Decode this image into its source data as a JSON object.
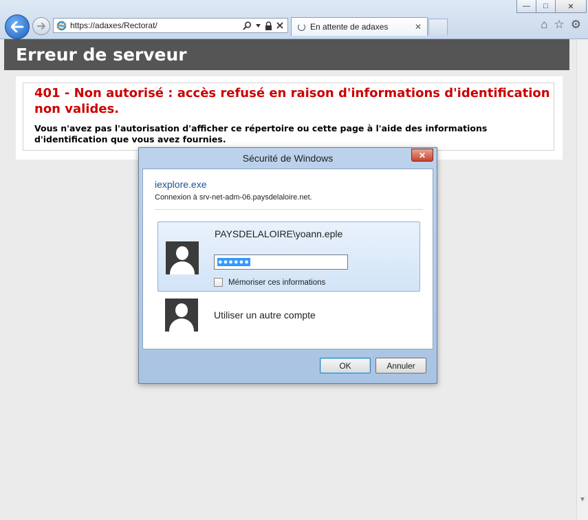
{
  "browser": {
    "url": "https://adaxes/Rectorat/",
    "tab_label": "En attente de adaxes",
    "window_controls": {
      "minimize": "—",
      "maximize": "□",
      "close": "✕"
    },
    "icons": [
      "back-arrow-icon",
      "forward-arrow-icon",
      "ie-logo-icon",
      "search-icon",
      "lock-icon",
      "stop-icon",
      "home-icon",
      "favorites-star-icon",
      "settings-gear-icon"
    ]
  },
  "page": {
    "header": "Erreur de serveur",
    "error_title": "401 - Non autorisé : accès refusé en raison d'informations d'identification non valides.",
    "error_description": "Vous n'avez pas l'autorisation d'afficher ce répertoire ou cette page à l'aide des informations d'identification que vous avez fournies."
  },
  "dialog": {
    "title": "Sécurité de Windows",
    "close_label": "✕",
    "app_name": "iexplore.exe",
    "connection_text": "Connexion à srv-net-adm-06.paysdelaloire.net.",
    "credential": {
      "username": "PAYSDELALOIRE\\yoann.eple",
      "password_mask": "●●●●●●",
      "remember_label": "Mémoriser ces informations",
      "remember_checked": false
    },
    "other_account_label": "Utiliser un autre compte",
    "ok_label": "OK",
    "cancel_label": "Annuler"
  },
  "colors": {
    "header_bg": "#555555",
    "error_red": "#cc0000",
    "link_blue": "#1d4f91",
    "selection_blue": "#3399ff"
  }
}
